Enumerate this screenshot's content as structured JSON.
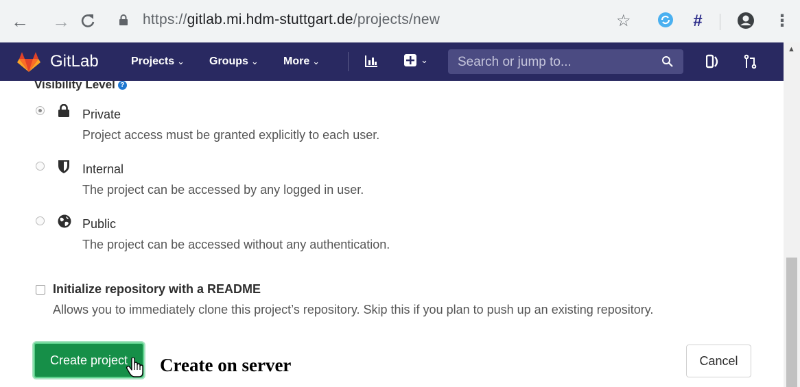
{
  "browser": {
    "url_scheme": "https://",
    "url_host": "gitlab.mi.hdm-stuttgart.de",
    "url_path": "/projects/new",
    "hash_ext_label": "#"
  },
  "header": {
    "brand": "GitLab",
    "menu": [
      {
        "label": "Projects"
      },
      {
        "label": "Groups"
      },
      {
        "label": "More"
      }
    ],
    "search_placeholder": "Search or jump to...",
    "brand_color": "#292961"
  },
  "visibility": {
    "label": "Visibility Level",
    "options": [
      {
        "title": "Private",
        "desc": "Project access must be granted explicitly to each user.",
        "icon": "lock-icon",
        "selected": true
      },
      {
        "title": "Internal",
        "desc": "The project can be accessed by any logged in user.",
        "icon": "shield-icon",
        "selected": false
      },
      {
        "title": "Public",
        "desc": "The project can be accessed without any authentication.",
        "icon": "globe-icon",
        "selected": false
      }
    ]
  },
  "readme": {
    "title": "Initialize repository with a README",
    "desc": "Allows you to immediately clone this project’s repository. Skip this if you plan to push up an existing repository.",
    "checked": false
  },
  "actions": {
    "create_label": "Create project",
    "cancel_label": "Cancel",
    "create_color": "#168f48"
  },
  "annotation": "Create on server"
}
